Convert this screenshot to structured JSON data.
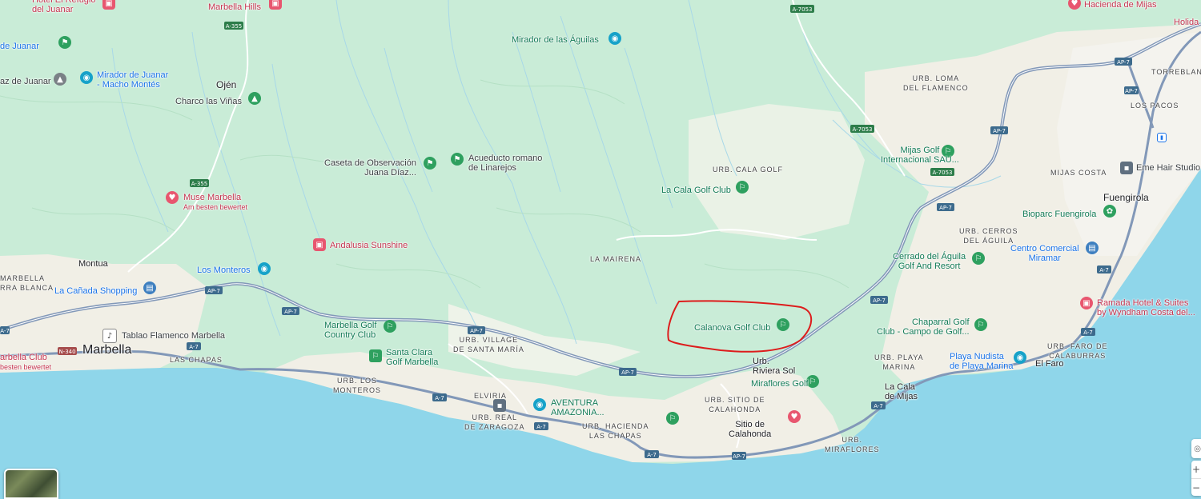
{
  "colors": {
    "land": "#c9ecd7",
    "urban": "#f2efe9",
    "sea": "#8fd6ea",
    "highway": "#8298b8",
    "outline": "#dd1c1c"
  },
  "labels": [
    {
      "id": "hotel-refugio",
      "text": "Hotel El Refugio\ndel Juanar"
    },
    {
      "id": "marbella-hills",
      "text": "Marbella Hills"
    },
    {
      "id": "de-juanar",
      "text": "de Juanar"
    },
    {
      "id": "mirador-aguilas",
      "text": "Mirador de las Águilas"
    },
    {
      "id": "hacienda-mijas",
      "text": "Hacienda de Mijas"
    },
    {
      "id": "holida",
      "text": "Holida"
    },
    {
      "id": "z-juanar",
      "text": "az de Juanar"
    },
    {
      "id": "mirador-juanar",
      "text": "Mirador de Juanar\n- Macho Montés"
    },
    {
      "id": "ojen",
      "text": "Ojén"
    },
    {
      "id": "charco",
      "text": "Charco las Viñas"
    },
    {
      "id": "urb-loma",
      "text": "URB. LOMA\nDEL FLAMENCO"
    },
    {
      "id": "torreblanca",
      "text": "TORREBLANC"
    },
    {
      "id": "los-pacos",
      "text": "LOS PACOS"
    },
    {
      "id": "caseta",
      "text": "Caseta de Observación\nJuana Díaz..."
    },
    {
      "id": "acueducto",
      "text": "Acueducto romano\nde Linarejos"
    },
    {
      "id": "mijas-golf",
      "text": "Mijas Golf\nInternacional SAU..."
    },
    {
      "id": "mijas-costa",
      "text": "MIJAS COSTA"
    },
    {
      "id": "eme-hair",
      "text": "Eme Hair Studio"
    },
    {
      "id": "urb-cala-golf",
      "text": "URB. CALA GOLF"
    },
    {
      "id": "la-cala-golf",
      "text": "La Cala Golf Club"
    },
    {
      "id": "fuengirola",
      "text": "Fuengirola"
    },
    {
      "id": "muse",
      "text": "Muse Marbella"
    },
    {
      "id": "muse-sub",
      "text": "Am besten bewertet"
    },
    {
      "id": "bioparc",
      "text": "Bioparc Fuengirola"
    },
    {
      "id": "urb-cerros",
      "text": "URB. CERROS\nDEL ÁGUILA"
    },
    {
      "id": "andalusia",
      "text": "Andalusia Sunshine"
    },
    {
      "id": "la-mairena",
      "text": "LA MAIRENA"
    },
    {
      "id": "centro-comercial",
      "text": "Centro Comercial\nMiramar"
    },
    {
      "id": "cerrado-aguila",
      "text": "Cerrado del Águila\nGolf And Resort"
    },
    {
      "id": "montua",
      "text": "Montua"
    },
    {
      "id": "los-monteros",
      "text": "Los Monteros"
    },
    {
      "id": "marbella-lbl",
      "text": "MARBELLA\nRRA BLANCA"
    },
    {
      "id": "canada",
      "text": "La Cañada Shopping"
    },
    {
      "id": "ramada",
      "text": "Ramada Hotel & Suites\nby Wyndham Costa del..."
    },
    {
      "id": "marbella-golf",
      "text": "Marbella Golf\nCountry Club"
    },
    {
      "id": "calanova",
      "text": "Calanova Golf Club"
    },
    {
      "id": "chaparral",
      "text": "Chaparral Golf\nClub - Campo de Golf..."
    },
    {
      "id": "tablao",
      "text": "Tablao Flamenco Marbella"
    },
    {
      "id": "urb-village",
      "text": "URB. VILLAGE\nDE SANTA MARÍA"
    },
    {
      "id": "urb-faro",
      "text": "URB. FARO DE\nCALABURRAS"
    },
    {
      "id": "marbella-club",
      "text": "arbella Club"
    },
    {
      "id": "marbella-club-sub",
      "text": "besten bewertet"
    },
    {
      "id": "marbella",
      "text": "Marbella"
    },
    {
      "id": "santa-clara",
      "text": "Santa Clara\nGolf Marbella"
    },
    {
      "id": "las-chapas",
      "text": "LAS CHAPAS"
    },
    {
      "id": "urb-riviera",
      "text": "Urb.\nRiviera Sol"
    },
    {
      "id": "urb-playa-marina",
      "text": "URB. PLAYA\nMARINA"
    },
    {
      "id": "playa-nudista",
      "text": "Playa Nudista\nde Playa Marina"
    },
    {
      "id": "el-faro",
      "text": "El Faro"
    },
    {
      "id": "miraflores-golf",
      "text": "Miraflores Golf"
    },
    {
      "id": "urb-los-monteros",
      "text": "URB. LOS\nMONTEROS"
    },
    {
      "id": "la-cala-mijas",
      "text": "La Cala\nde Mijas"
    },
    {
      "id": "elviria",
      "text": "ELVIRIA"
    },
    {
      "id": "aventura",
      "text": "AVENTURA\nAMAZONIA..."
    },
    {
      "id": "urb-sitio",
      "text": "URB. SITIO DE\nCALAHONDA"
    },
    {
      "id": "urb-real",
      "text": "URB. REAL\nDE ZARAGOZA"
    },
    {
      "id": "urb-hacienda",
      "text": "URB. HACIENDA\nLAS CHAPAS"
    },
    {
      "id": "sitio-calahonda",
      "text": "Sitio de\nCalahonda"
    },
    {
      "id": "urb-miraflores",
      "text": "URB.\nMIRAFLORES"
    }
  ],
  "roads": [
    "A-7053",
    "A-355",
    "A-355",
    "AP-7",
    "AP-7",
    "A-7053",
    "AP-7",
    "AP-7",
    "AP-7",
    "AP-7",
    "AP-7",
    "AP-7",
    "A-7",
    "A-7053",
    "AP-7",
    "AP-7",
    "AP-7",
    "A-7",
    "N-340",
    "A-7",
    "A-7",
    "A-7",
    "A-7",
    "AP-7",
    "A-7",
    "A-7",
    "AP-7",
    "A-7",
    "A-7"
  ],
  "controls": {
    "zoom_in": "+",
    "zoom_out": "−"
  }
}
